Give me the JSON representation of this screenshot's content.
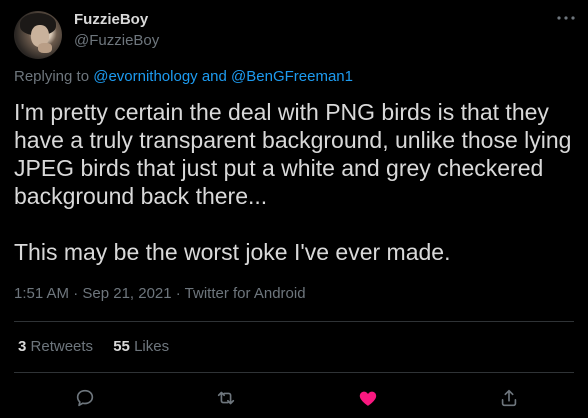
{
  "user": {
    "display_name": "FuzzieBoy",
    "handle": "@FuzzieBoy",
    "avatar_icon": "user-avatar"
  },
  "reply": {
    "prefix": "Replying to",
    "mentions": "@evornithology and @BenGFreeman1"
  },
  "tweet": {
    "text": "I'm pretty certain the deal with PNG birds is that they have a truly transparent background, unlike those lying JPEG birds that just put a white and grey checkered background back there...\n\nThis may be the worst joke I've ever made.",
    "timestamp": "1:51 AM · Sep 21, 2021 · Twitter for Android"
  },
  "stats": {
    "retweets_count": "3",
    "retweets_label": "Retweets",
    "likes_count": "55",
    "likes_label": "Likes"
  },
  "actions": {
    "reply_icon": "reply-icon",
    "retweet_icon": "retweet-icon",
    "like_icon": "heart-icon",
    "share_icon": "share-icon",
    "liked": true
  },
  "colors": {
    "background": "#000000",
    "text": "#d9d9d9",
    "secondary": "#6e767d",
    "link": "#1d9bf0",
    "like": "#f91880",
    "divider": "#2f3336"
  }
}
